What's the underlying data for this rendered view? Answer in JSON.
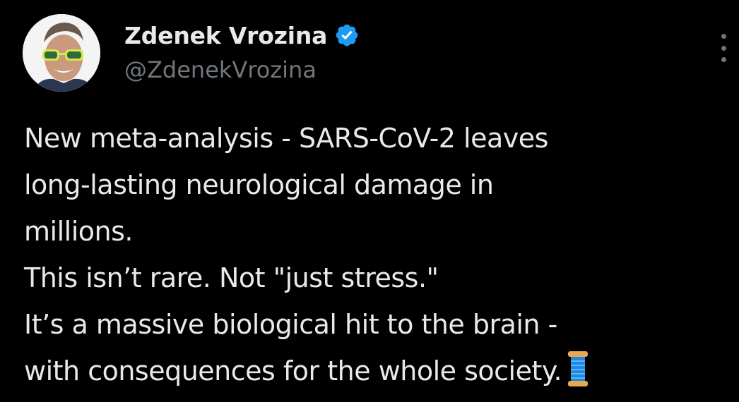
{
  "author": {
    "display_name": "Zdenek Vrozina",
    "handle": "@ZdenekVrozina",
    "verified": true,
    "verified_icon": "verified-badge-icon",
    "verified_color": "#1d9bf0"
  },
  "menu": {
    "icon": "more-vertical-icon"
  },
  "tweet": {
    "lines": [
      "New meta-analysis - SARS-CoV-2 leaves",
      "long-lasting neurological damage in",
      "millions.",
      "This isn’t rare. Not \"just stress.\"",
      "It’s a massive biological hit to the brain -",
      "with consequences for the whole society."
    ],
    "trailing_emoji": "thread-spool-icon"
  },
  "colors": {
    "background": "#000000",
    "primary_text": "#e7e9ea",
    "secondary_text": "#71767b"
  }
}
